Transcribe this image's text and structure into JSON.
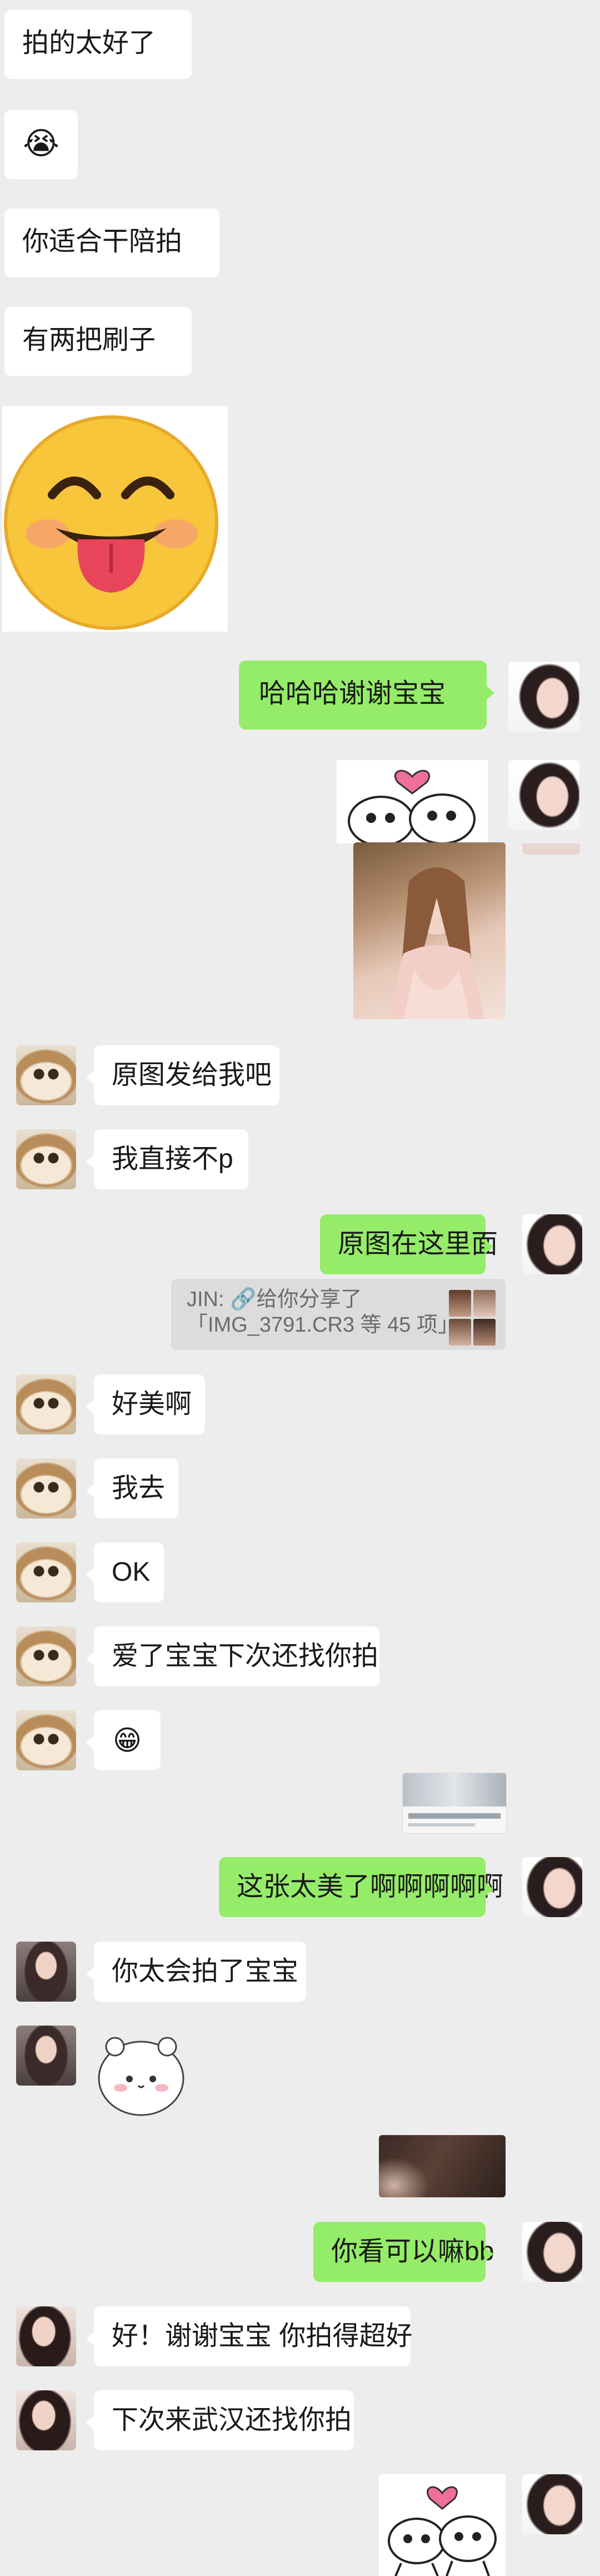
{
  "messages": {
    "m1": "拍的太好了",
    "m3": "你适合干陪拍",
    "m4": "有两把刷子",
    "m6": "哈哈哈谢谢宝宝",
    "m9": "原图发给我吧",
    "m10": "我直接不p",
    "m11": "原图在这里面",
    "m13": "好美啊",
    "m14": "我去",
    "m15": "OK",
    "m16": "爱了宝宝下次还找你拍",
    "m19": "这张太美了啊啊啊啊啊",
    "m20": "你太会拍了宝宝",
    "m23": "你看可以嘛bb",
    "m24": "好！谢谢宝宝 你拍得超好",
    "m25": "下次来武汉还找你拍"
  },
  "share": {
    "line1": "JIN: 🔗给你分享了",
    "line2": "「IMG_3791.CR3 等 45 项」"
  },
  "emoji": {
    "crying": "😭",
    "grinning": "😁"
  },
  "icons": {
    "big_sticker": "tongue-out-face",
    "cat_sticker": "two-cats-heart",
    "bear_sticker": "white-bear"
  },
  "colors": {
    "background": "#ededed",
    "outgoing_bubble": "#95ec69",
    "incoming_bubble": "#ffffff"
  }
}
